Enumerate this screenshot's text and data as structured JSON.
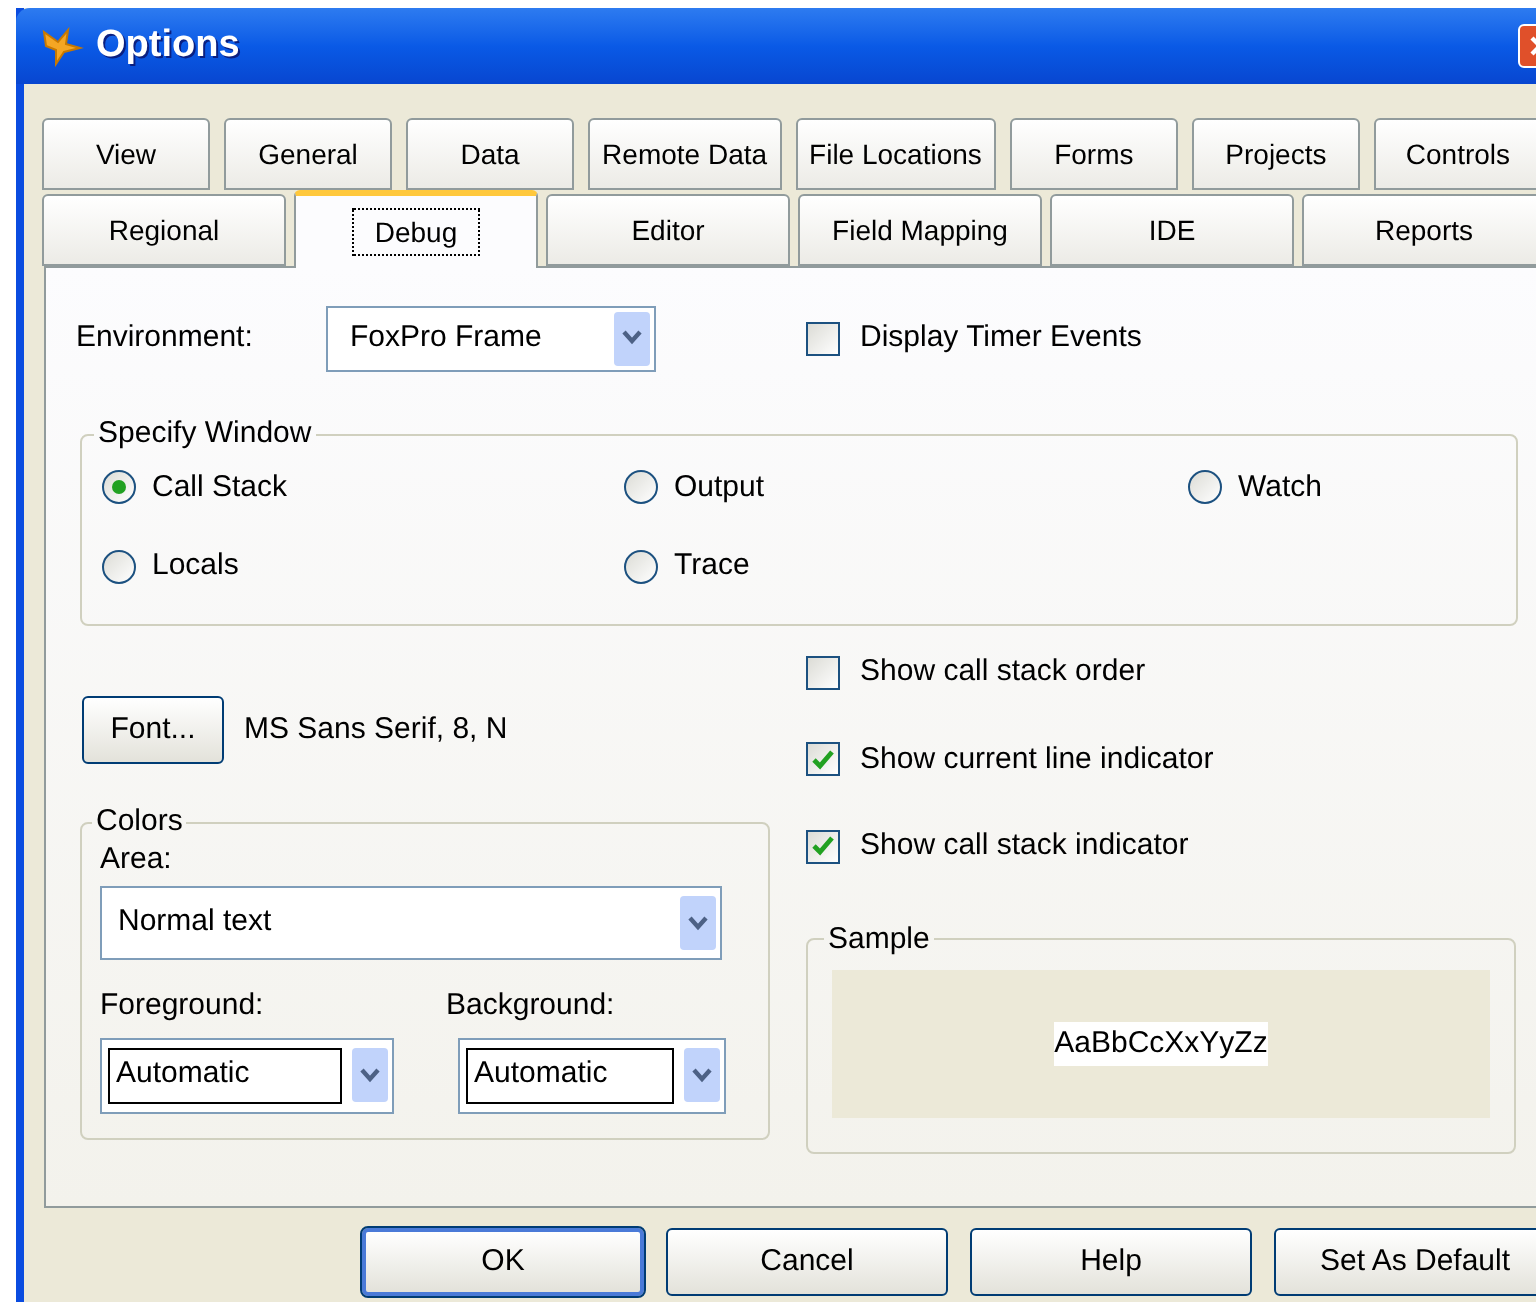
{
  "window": {
    "title": "Options"
  },
  "tab_rows": [
    [
      {
        "label": "View",
        "selected": false
      },
      {
        "label": "General",
        "selected": false
      },
      {
        "label": "Data",
        "selected": false
      },
      {
        "label": "Remote Data",
        "selected": false
      },
      {
        "label": "File Locations",
        "selected": false
      },
      {
        "label": "Forms",
        "selected": false
      },
      {
        "label": "Projects",
        "selected": false
      },
      {
        "label": "Controls",
        "selected": false
      }
    ],
    [
      {
        "label": "Regional",
        "selected": false
      },
      {
        "label": "Debug",
        "selected": true
      },
      {
        "label": "Editor",
        "selected": false
      },
      {
        "label": "Field Mapping",
        "selected": false
      },
      {
        "label": "IDE",
        "selected": false
      },
      {
        "label": "Reports",
        "selected": false
      }
    ]
  ],
  "environment": {
    "label": "Environment:",
    "value": "FoxPro Frame"
  },
  "display_timer_events": {
    "label": "Display Timer Events",
    "checked": false
  },
  "specify_window": {
    "legend": "Specify Window",
    "options": [
      {
        "label": "Call Stack",
        "selected": true
      },
      {
        "label": "Output",
        "selected": false
      },
      {
        "label": "Watch",
        "selected": false
      },
      {
        "label": "Locals",
        "selected": false
      },
      {
        "label": "Trace",
        "selected": false
      }
    ]
  },
  "font": {
    "button": "Font...",
    "value": "MS Sans Serif, 8, N"
  },
  "checkboxes": [
    {
      "label": "Show call stack order",
      "checked": false
    },
    {
      "label": "Show current line indicator",
      "checked": true
    },
    {
      "label": "Show call stack indicator",
      "checked": true
    }
  ],
  "colors": {
    "legend": "Colors",
    "area_label": "Area:",
    "area": "Normal text",
    "foreground_label": "Foreground:",
    "foreground": "Automatic",
    "background_label": "Background:",
    "background": "Automatic"
  },
  "sample": {
    "legend": "Sample",
    "text": "AaBbCcXxYyZz"
  },
  "buttons": [
    {
      "label": "OK",
      "default": true
    },
    {
      "label": "Cancel",
      "default": false
    },
    {
      "label": "Help",
      "default": false
    },
    {
      "label": "Set As Default",
      "default": false
    }
  ]
}
